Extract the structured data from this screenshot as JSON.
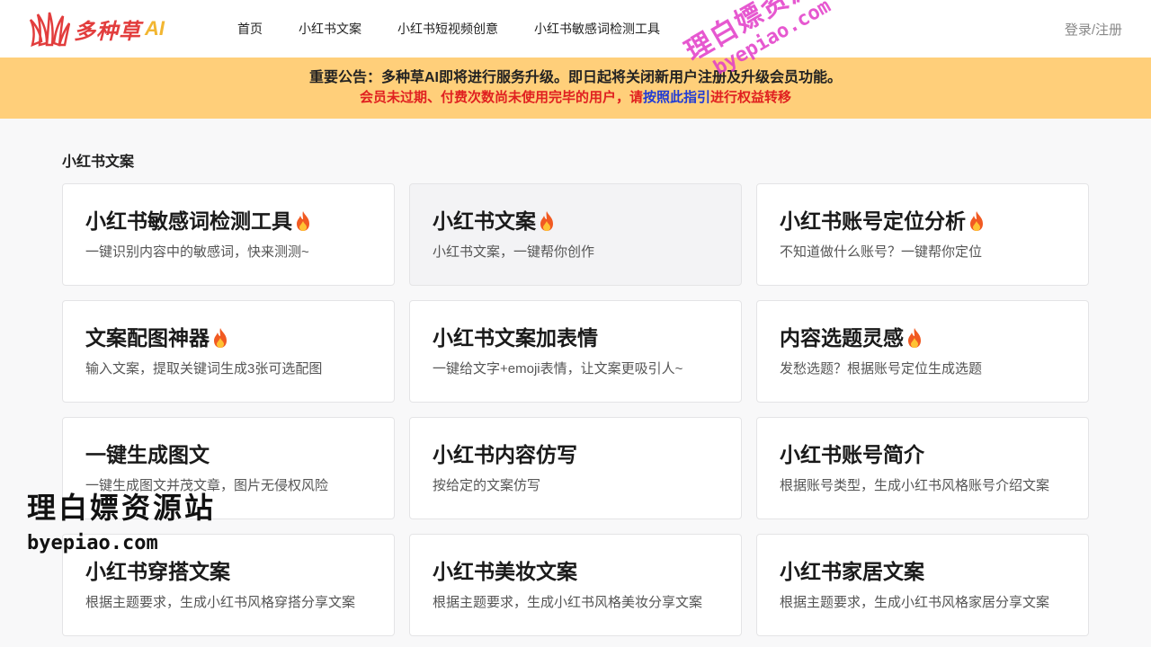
{
  "header": {
    "logo_text": "多种草",
    "logo_ai": "AI",
    "nav": [
      "首页",
      "小红书文案",
      "小红书短视频创意",
      "小红书敏感词检测工具"
    ],
    "login": "登录/注册"
  },
  "notice": {
    "line1": "重要公告：多种草AI即将进行服务升级。即日起将关闭新用户注册及升级会员功能。",
    "line2_before": "会员未过期、付费次数尚未使用完毕的用户，请",
    "line2_link": "按照此指引",
    "line2_after": "进行权益转移"
  },
  "section_title": "小红书文案",
  "cards": [
    {
      "title": "小红书敏感词检测工具",
      "desc": "一键识别内容中的敏感词，快来测测~",
      "fire": true
    },
    {
      "title": "小红书文案",
      "desc": "小红书文案，一键帮你创作",
      "fire": true
    },
    {
      "title": "小红书账号定位分析",
      "desc": "不知道做什么账号？一键帮你定位",
      "fire": true
    },
    {
      "title": "文案配图神器",
      "desc": "输入文案，提取关键词生成3张可选配图",
      "fire": true
    },
    {
      "title": "小红书文案加表情",
      "desc": "一键给文字+emoji表情，让文案更吸引人~",
      "fire": false
    },
    {
      "title": "内容选题灵感",
      "desc": "发愁选题？根据账号定位生成选题",
      "fire": true
    },
    {
      "title": "一键生成图文",
      "desc": "一键生成图文并茂文章，图片无侵权风险",
      "fire": false
    },
    {
      "title": "小红书内容仿写",
      "desc": "按给定的文案仿写",
      "fire": false
    },
    {
      "title": "小红书账号简介",
      "desc": "根据账号类型，生成小红书风格账号介绍文案",
      "fire": false
    },
    {
      "title": "小红书穿搭文案",
      "desc": "根据主题要求，生成小红书风格穿搭分享文案",
      "fire": false
    },
    {
      "title": "小红书美妆文案",
      "desc": "根据主题要求，生成小红书风格美妆分享文案",
      "fire": false
    },
    {
      "title": "小红书家居文案",
      "desc": "根据主题要求，生成小红书风格家居分享文案",
      "fire": false
    }
  ],
  "watermark": {
    "cn": "理白嫖资源站",
    "en": "byepiao.com"
  },
  "colors": {
    "brand_red": "#e23d3d",
    "brand_yellow": "#f2b632",
    "notice_bg": "#ffcf7a",
    "notice_red": "#e02020",
    "link_blue": "#1f3bd6"
  }
}
